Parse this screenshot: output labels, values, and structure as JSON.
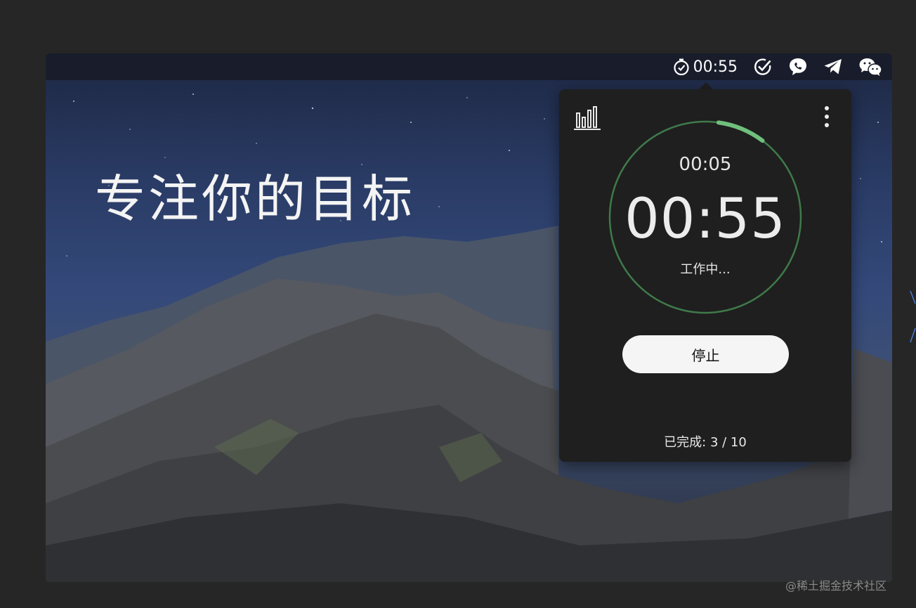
{
  "menubar": {
    "timer_text": "00:55",
    "icons": [
      "stopwatch-icon",
      "check-circle-icon",
      "chat-bubble-icon",
      "telegram-icon",
      "wechat-icon"
    ]
  },
  "hero": {
    "headline": "专注你的目标"
  },
  "popup": {
    "elapsed": "00:05",
    "remaining": "00:55",
    "status": "工作中...",
    "stop_label": "停止",
    "completed_text": "已完成: 3 / 10",
    "progress_fraction": 0.08,
    "ring_color": "#3f7a4a",
    "progress_color": "#6fc07d"
  },
  "watermark": "@稀土掘金技术社区"
}
